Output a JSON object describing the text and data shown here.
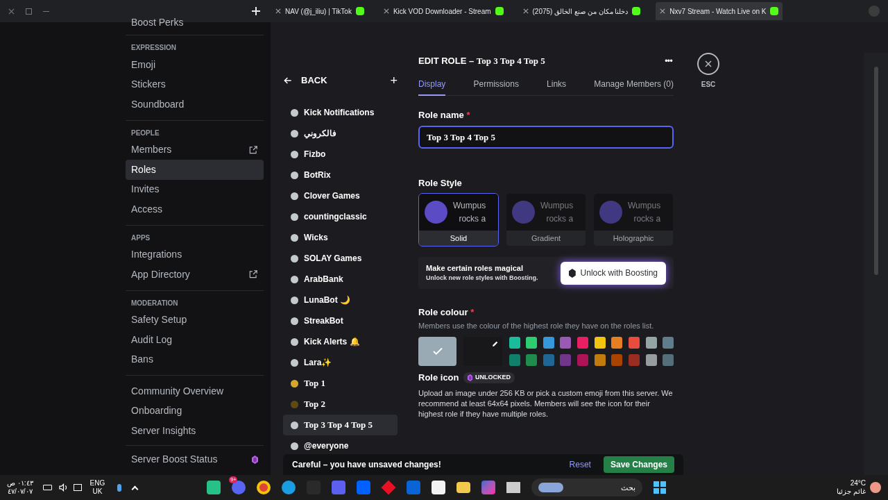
{
  "browser": {
    "tabs": [
      {
        "title": "NAV (@j_iliu) | TikTok",
        "selected": false
      },
      {
        "title": "Kick VOD Downloader - Stream",
        "selected": false
      },
      {
        "title": "(2075) دخلنا مكان من صنع الخالق",
        "selected": false
      },
      {
        "title": "Nxv7 Stream - Watch Live on K",
        "selected": true
      }
    ]
  },
  "sidebar": {
    "top_item": "Boost Perks",
    "sections": [
      {
        "heading": "EXPRESSION",
        "items": [
          {
            "label": "Emoji",
            "selected": false,
            "external": false
          },
          {
            "label": "Stickers",
            "selected": false,
            "external": false
          },
          {
            "label": "Soundboard",
            "selected": false,
            "external": false
          }
        ]
      },
      {
        "heading": "PEOPLE",
        "items": [
          {
            "label": "Members",
            "selected": false,
            "external": true
          },
          {
            "label": "Roles",
            "selected": true,
            "external": false
          },
          {
            "label": "Invites",
            "selected": false,
            "external": false
          },
          {
            "label": "Access",
            "selected": false,
            "external": false
          }
        ]
      },
      {
        "heading": "APPS",
        "items": [
          {
            "label": "Integrations",
            "selected": false,
            "external": false
          },
          {
            "label": "App Directory",
            "selected": false,
            "external": true
          }
        ]
      },
      {
        "heading": "MODERATION",
        "items": [
          {
            "label": "Safety Setup",
            "selected": false,
            "external": false
          },
          {
            "label": "Audit Log",
            "selected": false,
            "external": false
          },
          {
            "label": "Bans",
            "selected": false,
            "external": false
          }
        ]
      },
      {
        "items": [
          {
            "label": "Community Overview",
            "selected": false,
            "external": false
          },
          {
            "label": "Onboarding",
            "selected": false,
            "external": false
          },
          {
            "label": "Server Insights",
            "selected": false,
            "external": false
          }
        ]
      }
    ],
    "boost_status": "Server Boost Status"
  },
  "roles_panel": {
    "back": "BACK",
    "add": "+",
    "roles": [
      {
        "name": "Kick Notifications",
        "color": "#c4c9ce",
        "selected": false,
        "custom_font": false
      },
      {
        "name": "فالكروني",
        "color": "#c4c9ce",
        "selected": false,
        "custom_font": false
      },
      {
        "name": "Fizbo",
        "color": "#c4c9ce",
        "selected": false,
        "custom_font": false
      },
      {
        "name": "BotRix",
        "color": "#c4c9ce",
        "selected": false,
        "custom_font": false
      },
      {
        "name": "Clover Games",
        "color": "#c4c9ce",
        "selected": false,
        "custom_font": false
      },
      {
        "name": "countingclassic",
        "color": "#c4c9ce",
        "selected": false,
        "custom_font": false
      },
      {
        "name": "Wicks",
        "color": "#c4c9ce",
        "selected": false,
        "custom_font": false
      },
      {
        "name": "SOLAY Games",
        "color": "#c4c9ce",
        "selected": false,
        "custom_font": false
      },
      {
        "name": "ArabBank",
        "color": "#c4c9ce",
        "selected": false,
        "custom_font": false
      },
      {
        "name": "LunaBot 🌙",
        "color": "#c4c9ce",
        "selected": false,
        "custom_font": false
      },
      {
        "name": "StreakBot",
        "color": "#c4c9ce",
        "selected": false,
        "custom_font": false
      },
      {
        "name": "Kick Alerts 🔔",
        "color": "#c4c9ce",
        "selected": false,
        "custom_font": false
      },
      {
        "name": "Lara✨",
        "color": "#c4c9ce",
        "selected": false,
        "custom_font": false
      },
      {
        "name": "Top 1",
        "color": "#d4a72c",
        "selected": false,
        "custom_font": true
      },
      {
        "name": "Top 2",
        "color": "#5c4a12",
        "selected": false,
        "custom_font": true
      },
      {
        "name": "Top 3 Top 4 Top 5",
        "color": "#c4c9ce",
        "selected": true,
        "custom_font": true
      },
      {
        "name": "@everyone",
        "color": "#c4c9ce",
        "selected": false,
        "custom_font": false
      }
    ]
  },
  "editor": {
    "title_prefix": "EDIT ROLE – ",
    "title_role": "Top 3 Top 4 Top 5",
    "more": "•••",
    "tabs": [
      {
        "label": "Display",
        "selected": true
      },
      {
        "label": "Permissions",
        "selected": false
      },
      {
        "label": "Links",
        "selected": false
      },
      {
        "label": "Manage Members (0)",
        "selected": false
      }
    ],
    "close_label": "ESC",
    "role_name_label": "Role name",
    "required": "*",
    "role_name_value": "Top 3 Top 4 Top 5",
    "role_style_label": "Role Style",
    "styles": [
      {
        "label": "Solid",
        "line1": "Wumpus",
        "line2": "rocks a",
        "selected": true,
        "locked": false
      },
      {
        "label": "Gradient",
        "line1": "Wumpus",
        "line2": "rocks a",
        "selected": false,
        "locked": true
      },
      {
        "label": "Holographic",
        "line1": "Wumpus",
        "line2": "rocks a",
        "selected": false,
        "locked": true
      }
    ],
    "promo": {
      "text": "Make certain roles **magical**",
      "subtext": "Unlock new role styles with Boosting.",
      "button": "Unlock with Boosting"
    },
    "colour_label": "Role colour",
    "colour_hint": "Members use the colour of the highest role they have on the roles list.",
    "default_colour": {
      "color": "#99aab5",
      "selected": true
    },
    "colours": [
      {
        "color": "#1abc9c",
        "selected": false
      },
      {
        "color": "#2ecc71",
        "selected": false
      },
      {
        "color": "#3498db",
        "selected": false
      },
      {
        "color": "#9b59b6",
        "selected": false
      },
      {
        "color": "#e91e63",
        "selected": false
      },
      {
        "color": "#f1c40f",
        "selected": false
      },
      {
        "color": "#e67e22",
        "selected": false
      },
      {
        "color": "#e74c3c",
        "selected": false
      },
      {
        "color": "#95a5a6",
        "selected": false
      },
      {
        "color": "#607d8b",
        "selected": false
      },
      {
        "color": "#11806a",
        "selected": false
      },
      {
        "color": "#1f8b4c",
        "selected": false
      },
      {
        "color": "#206694",
        "selected": false
      },
      {
        "color": "#71368a",
        "selected": false
      },
      {
        "color": "#ad1457",
        "selected": false
      },
      {
        "color": "#c27c0e",
        "selected": false
      },
      {
        "color": "#a84300",
        "selected": false
      },
      {
        "color": "#992d22",
        "selected": false
      },
      {
        "color": "#979c9f",
        "selected": false
      },
      {
        "color": "#546e7a",
        "selected": false
      }
    ],
    "icon_label": "Role icon",
    "icon_badge": "UNLOCKED",
    "icon_hint": "Upload an image under 256 KB or pick a custom emoji from this server. We recommend at least 64x64 pixels. Members will see the icon for their highest role if they have multiple roles."
  },
  "unsaved": {
    "text": "Careful – you have unsaved changes!",
    "reset": "Reset",
    "save": "Save Changes"
  },
  "taskbar": {
    "time": "٠١:٤٣ ص",
    "date": "٤٧/٠٧/٠٧",
    "lang1": "ENG",
    "lang2": "UK",
    "search": "بحث",
    "temp": "24°C",
    "weather": "غائم جزئيا",
    "discord_badge": "9+"
  }
}
